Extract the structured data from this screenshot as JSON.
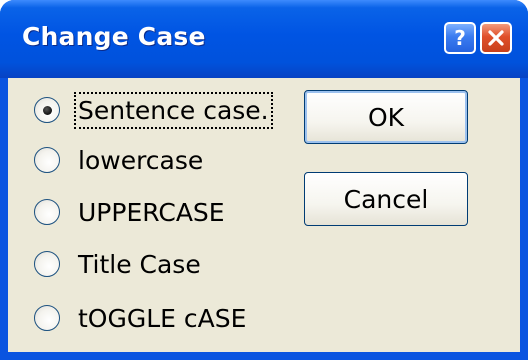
{
  "window": {
    "title": "Change Case"
  },
  "titlebar_buttons": {
    "help_icon": "question-icon",
    "close_icon": "close-x-icon"
  },
  "options": [
    {
      "label": "Sentence case.",
      "selected": true
    },
    {
      "label": "lowercase",
      "selected": false
    },
    {
      "label": "UPPERCASE",
      "selected": false
    },
    {
      "label": "Title Case",
      "selected": false
    },
    {
      "label": "tOGGLE cASE",
      "selected": false
    }
  ],
  "buttons": {
    "ok": "OK",
    "cancel": "Cancel"
  },
  "colors": {
    "titlebar": "#0054e3",
    "client_bg": "#ece9d8",
    "close_button": "#e0502a",
    "help_button": "#3b7cf0"
  }
}
